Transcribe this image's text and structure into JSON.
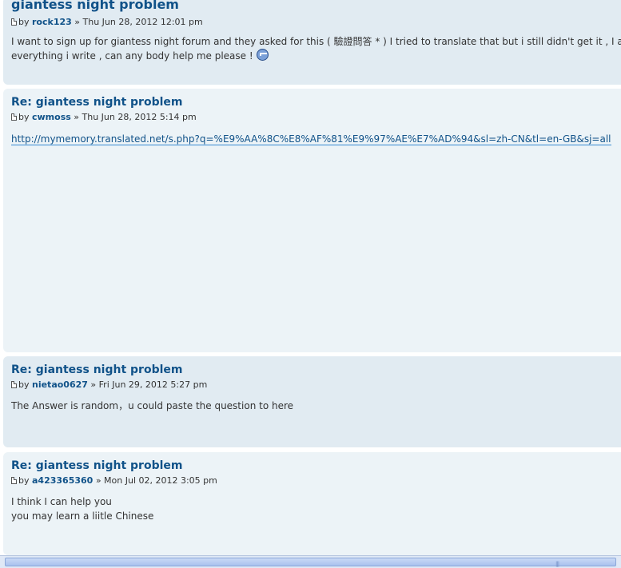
{
  "posts": [
    {
      "title": "giantess night problem",
      "by": "by",
      "author": "rock123",
      "date": "» Thu Jun 28, 2012 12:01 pm",
      "lines": [
        "I want to sign up for giantess night forum and they asked for this ( 驗證問答 * ) I tried to translate that but i still didn't get it , I a",
        "everything i write , can any body help me please !"
      ]
    },
    {
      "title": "Re: giantess night problem",
      "by": "by",
      "author": "cwmoss",
      "date": "» Thu Jun 28, 2012 5:14 pm",
      "link": "http://mymemory.translated.net/s.php?q=%E9%AA%8C%E8%AF%81%E9%97%AE%E7%AD%94&sl=zh-CN&tl=en-GB&sj=all"
    },
    {
      "title": "Re: giantess night problem",
      "by": "by",
      "author": "nietao0627",
      "date": "» Fri Jun 29, 2012 5:27 pm",
      "lines": [
        "The Answer is random，u could paste the question to here"
      ]
    },
    {
      "title": "Re: giantess night problem",
      "by": "by",
      "author": "a423365360",
      "date": "» Mon Jul 02, 2012 3:05 pm",
      "lines": [
        "I think I can help you",
        "you may learn a liitle Chinese"
      ]
    }
  ],
  "icons": {
    "post_icon": "document-icon",
    "smiley": "crying-smiley-icon",
    "scroll_grip": "grip-icon"
  },
  "colors": {
    "post_bg_dark": "#e1ebf2",
    "post_bg_light": "#ecf3f7",
    "title": "#105289"
  }
}
